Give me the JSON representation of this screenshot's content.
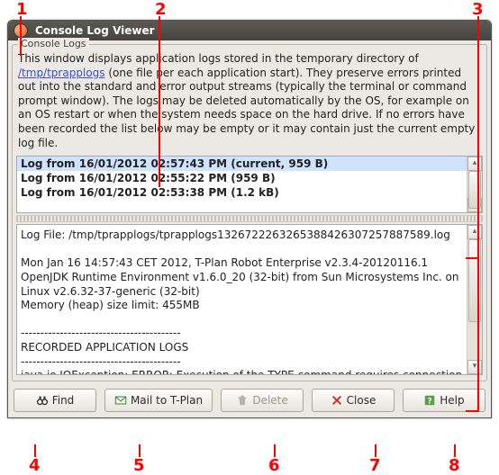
{
  "callouts": {
    "c1": "1",
    "c2": "2",
    "c3": "3",
    "c4": "4",
    "c5": "5",
    "c6": "6",
    "c7": "7",
    "c8": "8"
  },
  "window": {
    "title": "Console Log Viewer"
  },
  "group": {
    "label": "Console Logs"
  },
  "desc": {
    "pre": "This window displays application logs stored in the temporary directory of ",
    "link": "/tmp/tprapplogs",
    "post": " (one file per each application start). They preserve errors printed out into the standard and error output streams (typically the terminal or command prompt window). The logs may be deleted automatically by the OS, for example on an OS restart or when the system needs space on the hard drive. If no errors have been recorded the list below may be empty or it may contain just the current empty log file."
  },
  "list": {
    "rows": [
      "Log from 16/01/2012 02:57:43 PM (current, 959 B)",
      "Log from 16/01/2012 02:55:22 PM (959 B)",
      "Log from 16/01/2012 02:53:38 PM (1.2 kB)"
    ]
  },
  "log": {
    "body": "Log File: /tmp/tprapplogs/tprapplogs1326722263265388426307257887589.log\n\nMon Jan 16 14:57:43 CET 2012, T-Plan Robot Enterprise v2.3.4-20120116.1\nOpenJDK Runtime Environment v1.6.0_20 (32-bit) from Sun Microsystems Inc. on Linux v2.6.32-37-generic (32-bit)\nMemory (heap) size limit: 455MB\n\n-----------------------------------------\nRECORDED APPLICATION LOGS\n-----------------------------------------\njava.io.IOException: ERROR: Execution of the TYPE command requires connection to a desktop."
  },
  "buttons": {
    "find": "Find",
    "mail": "Mail to T-Plan",
    "delete": "Delete",
    "close": "Close",
    "help": "Help"
  }
}
